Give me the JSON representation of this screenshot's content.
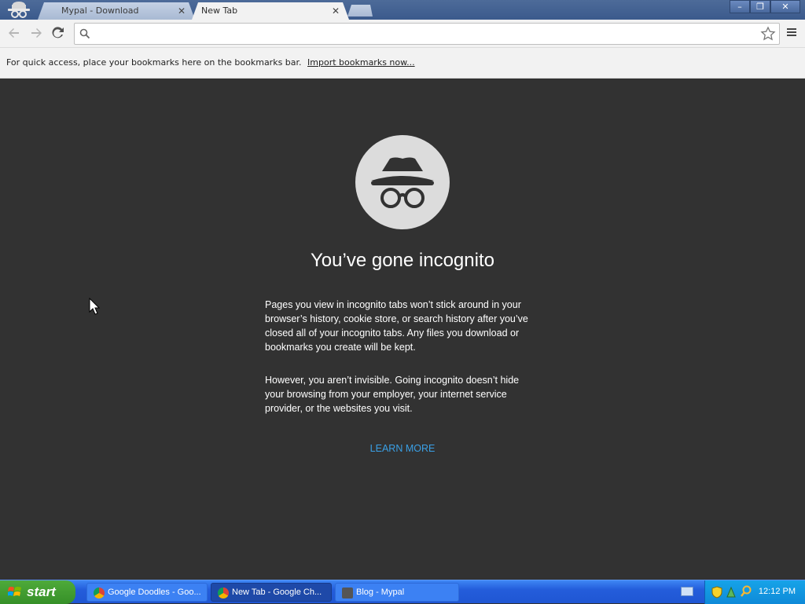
{
  "tabs": [
    {
      "title": "Mypal - Download",
      "close": "✕"
    },
    {
      "title": "New Tab",
      "close": "✕"
    }
  ],
  "window_controls": {
    "minimize": "–",
    "restore": "❐",
    "close": "✕"
  },
  "omnibox": {
    "value": "",
    "placeholder": ""
  },
  "bookmarks_bar": {
    "text": "For quick access, place your bookmarks here on the bookmarks bar.",
    "link": "Import bookmarks now..."
  },
  "incognito": {
    "heading": "You’ve gone incognito",
    "para1": "Pages you view in incognito tabs won’t stick around in your browser’s history, cookie store, or search history after you’ve closed all of your incognito tabs. Any files you download or bookmarks you create will be kept.",
    "para2": "However, you aren’t invisible. Going incognito doesn’t hide your browsing from your employer, your internet service provider, or the websites you visit.",
    "learn_more": "LEARN MORE"
  },
  "taskbar": {
    "start": "start",
    "tasks": [
      {
        "label": "Google Doodles - Goo..."
      },
      {
        "label": "New Tab - Google Ch..."
      },
      {
        "label": "Blog - Mypal"
      }
    ],
    "clock": "12:12 PM"
  },
  "colors": {
    "accent_link": "#3aa0e6",
    "page_bg": "#323232",
    "taskbar": "#245ddb"
  }
}
